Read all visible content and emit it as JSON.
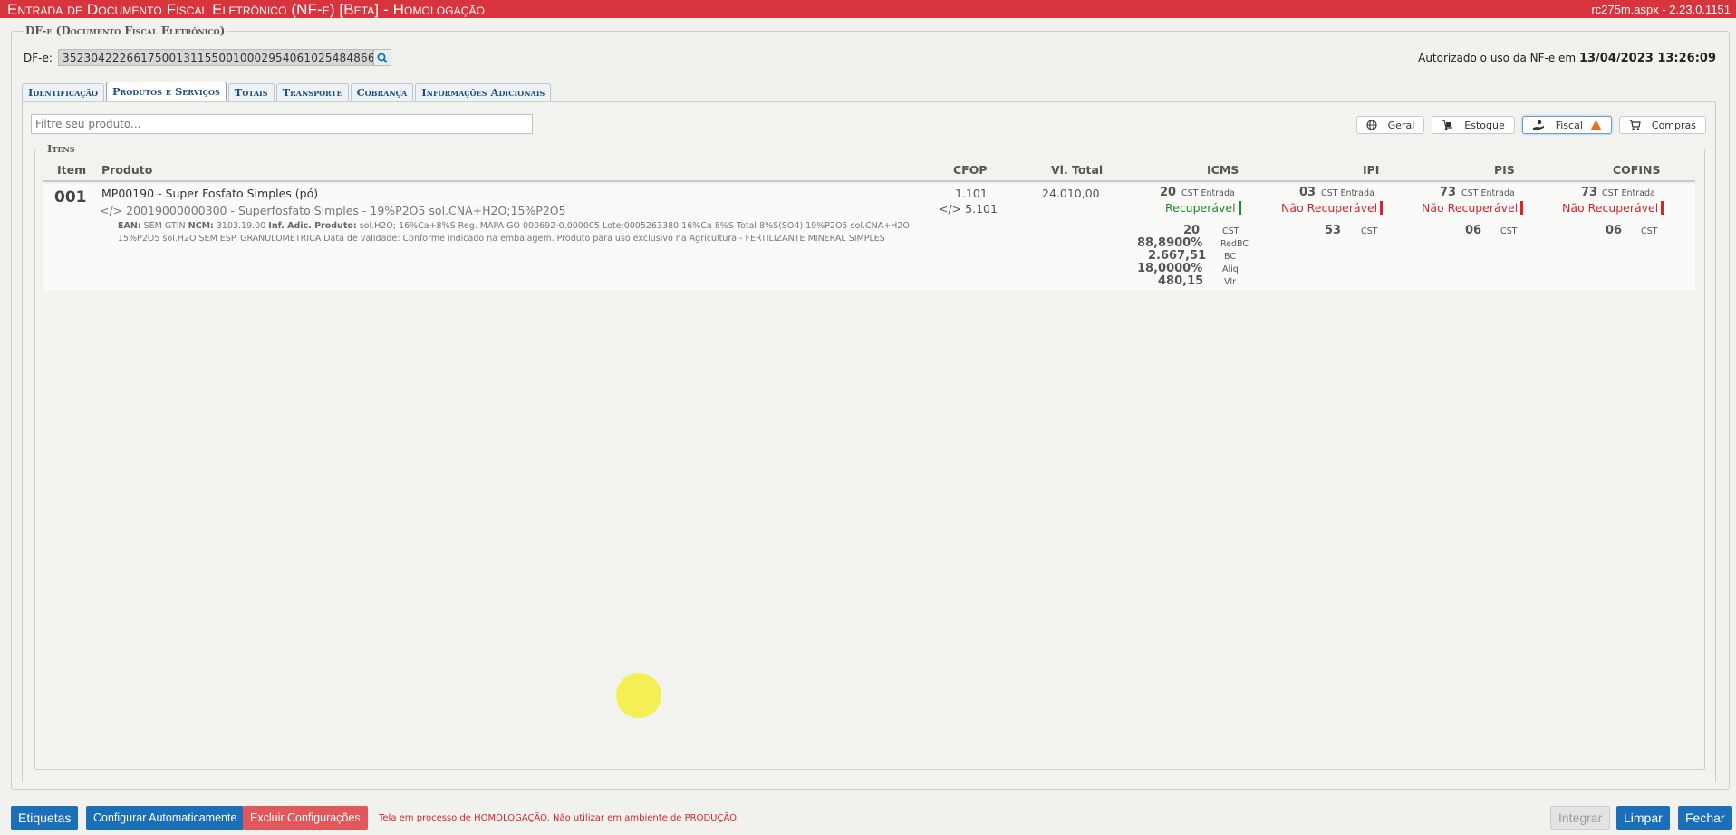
{
  "window": {
    "title": "Entrada de Documento Fiscal Eletrônico (NF-e) [Beta]  - Homologação",
    "version": "rc275m.aspx - 2.23.0.1151"
  },
  "dfe": {
    "legend": "DF-e (Documento Fiscal Eletrônico)",
    "label": "DF-e:",
    "key": "35230422266175001311550010002954061025484866",
    "auth_text": "Autorizado o uso da NF-e em",
    "auth_date": "13/04/2023 13:26:09"
  },
  "tabs": [
    {
      "label": "Identificação",
      "active": false
    },
    {
      "label": "Produtos e Serviços",
      "active": true
    },
    {
      "label": "Totais",
      "active": false
    },
    {
      "label": "Transporte",
      "active": false
    },
    {
      "label": "Cobrança",
      "active": false
    },
    {
      "label": "Informações Adicionais",
      "active": false
    }
  ],
  "filter": {
    "placeholder": "Filtre seu produto..."
  },
  "views": [
    {
      "label": "Geral",
      "icon": "globe-icon"
    },
    {
      "label": "Estoque",
      "icon": "hand-truck-icon"
    },
    {
      "label": "Fiscal",
      "icon": "hand-coin-icon",
      "warning": true,
      "active": true
    },
    {
      "label": "Compras",
      "icon": "cart-icon"
    }
  ],
  "items": {
    "legend": "Itens",
    "headers": {
      "item": "Item",
      "produto": "Produto",
      "cfop": "CFOP",
      "vl_total": "Vl. Total",
      "icms": "ICMS",
      "ipi": "IPI",
      "pis": "PIS",
      "cofins": "COFINS"
    },
    "rows": [
      {
        "item": "001",
        "product_code_desc": "MP00190 - Super Fosfato Simples (pó)",
        "xml_icon": "</>",
        "supplier_code_desc": "20019000000300 - Superfosfato Simples - 19%P2O5 sol.CNA+H2O;15%P2O5",
        "ean_label": "EAN:",
        "ean_value": "SEM GTIN",
        "ncm_label": "NCM:",
        "ncm_value": "3103.19.00",
        "inf_label": "Inf. Adic. Produto:",
        "inf_value": "sol.H2O; 16%Ca+8%S Reg. MAPA GO 000692-0.000005 Lote:0005263380 16%Ca 8%S Total 8%S(SO4) 19%P2O5 sol.CNA+H2O 15%P2O5 sol.H2O SEM ESP. GRANULOMETRICA Data de validade: Conforme indicado na embalagem. Produto para uso exclusivo na Agricultura - FERTILIZANTE MINERAL SIMPLES",
        "cfop_entry": "1.101",
        "cfop_orig": "5.101",
        "vl_total": "24.010,00",
        "icms": {
          "cst_entrada": "20",
          "cst_entrada_label": "CST Entrada",
          "status": "Recuperável",
          "cst": "20",
          "cst_label": "CST",
          "redbc": "88,8900%",
          "redbc_label": "RedBC",
          "bc": "2.667,51",
          "bc_label": "BC",
          "aliq": "18,0000%",
          "aliq_label": "Aliq",
          "vlr": "480,15",
          "vlr_label": "Vlr"
        },
        "ipi": {
          "cst_entrada": "03",
          "cst_entrada_label": "CST Entrada",
          "status": "Não Recuperável",
          "cst": "53",
          "cst_label": "CST"
        },
        "pis": {
          "cst_entrada": "73",
          "cst_entrada_label": "CST Entrada",
          "status": "Não Recuperável",
          "cst": "06",
          "cst_label": "CST"
        },
        "cofins": {
          "cst_entrada": "73",
          "cst_entrada_label": "CST Entrada",
          "status": "Não Recuperável",
          "cst": "06",
          "cst_label": "CST"
        }
      }
    ]
  },
  "footer": {
    "etiquetas": "Etiquetas",
    "configurar": "Configurar Automaticamente",
    "excluir": "Excluir Configurações",
    "warning": "Tela em processo de HOMOLOGAÇÃO. Não utilizar em ambiente de PRODUÇÃO.",
    "integrar": "Integrar",
    "limpar": "Limpar",
    "fechar": "Fechar"
  },
  "colors": {
    "title_bar": "#d8343d",
    "accent_blue": "#1b6fb8",
    "recoverable": "#1f8b24",
    "non_recoverable": "#d3262f"
  }
}
